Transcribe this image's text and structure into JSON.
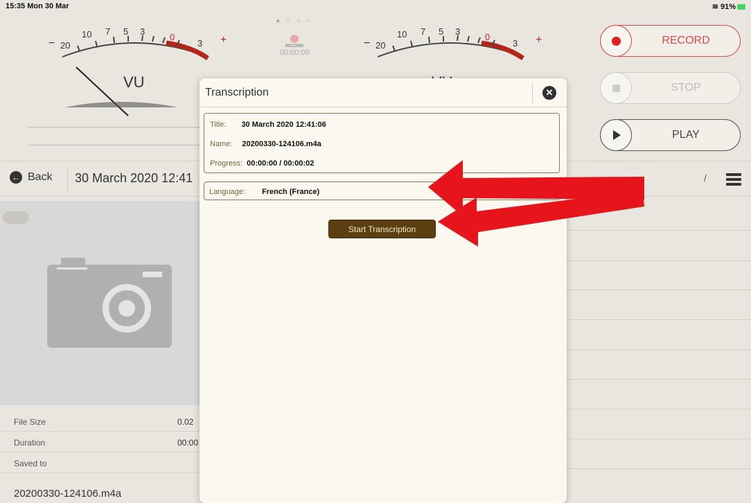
{
  "status": {
    "time": "15:35  Mon 30 Mar",
    "battery": "91%"
  },
  "meters": {
    "left": {
      "tick_labels": [
        "−",
        "20",
        "10",
        "7",
        "5",
        "3",
        "0",
        "3",
        "+"
      ],
      "label": "VU"
    },
    "right": {
      "tick_labels": [
        "−",
        "20",
        "10",
        "7",
        "5",
        "3",
        "0",
        "3",
        "+"
      ],
      "label": "VU"
    }
  },
  "center": {
    "page_dots": "● ○ ○ ○",
    "record_label": "RECORD",
    "record_time": "00:00:00"
  },
  "controls": {
    "record": "RECORD",
    "stop": "STOP",
    "play": "PLAY"
  },
  "nav": {
    "back": "Back",
    "title": "30 March 2020 12:41"
  },
  "details": {
    "file_size_label": "File Size",
    "file_size_value": "0.02",
    "duration_label": "Duration",
    "duration_value": "00:00",
    "saved_to_label": "Saved to",
    "filename": "20200330-124106.m4a"
  },
  "modal": {
    "title": "Transcription",
    "title_label": "Title:",
    "title_value": "30 March 2020 12:41:06",
    "name_label": "Name:",
    "name_value": "20200330-124106.m4a",
    "progress_label": "Progress:",
    "progress_value": "00:00:00 / 00:00:02",
    "language_label": "Language:",
    "language_value": "French (France)",
    "start_button": "Start Transcription"
  },
  "colors": {
    "accent_red": "#e24a4a",
    "arrow_red": "#e8141c",
    "button_brown": "#5b3f11"
  }
}
